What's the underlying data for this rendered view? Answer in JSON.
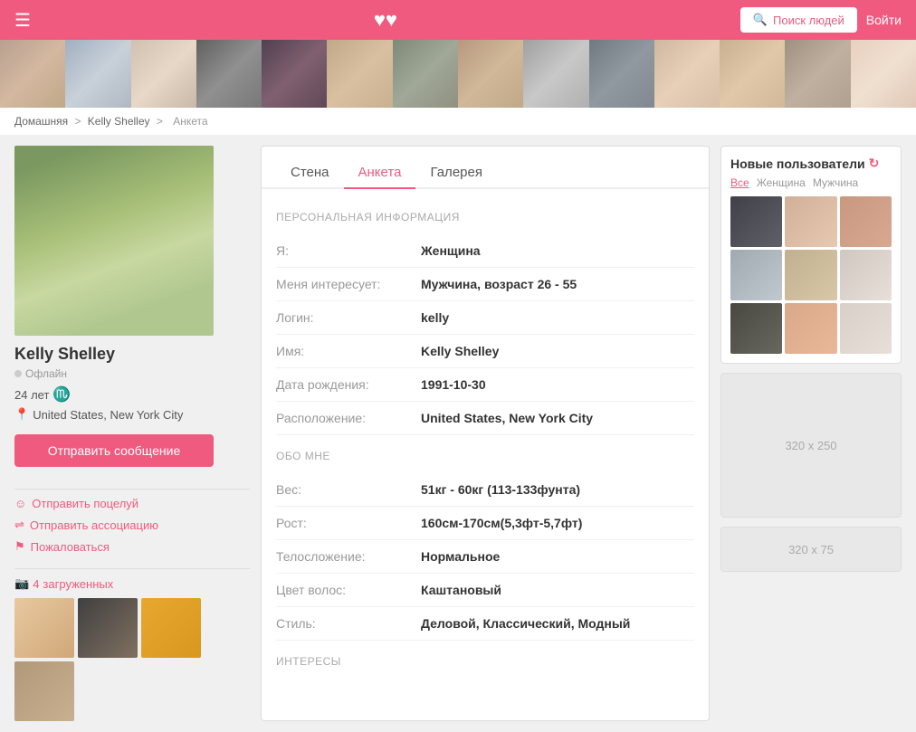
{
  "header": {
    "search_btn": "Поиск людей",
    "login_btn": "Войти"
  },
  "breadcrumb": {
    "home": "Домашняя",
    "sep1": ">",
    "name": "Kelly Shelley",
    "sep2": ">",
    "page": "Анкета"
  },
  "profile": {
    "name": "Kelly Shelley",
    "status": "Офлайн",
    "age": "24 лет",
    "zodiac": "♏",
    "location": "United States, New York City",
    "send_msg": "Отправить сообщение",
    "action_kiss": "Отправить поцелуй",
    "action_assoc": "Отправить ассоциацию",
    "action_report": "Пожаловаться",
    "uploads_label": "загруженных",
    "uploads_count": "4"
  },
  "tabs": {
    "wall": "Стена",
    "anketa": "Анкета",
    "gallery": "Галерея"
  },
  "personal_info": {
    "section_title": "ПЕРСОНАЛЬНАЯ ИНФОРМАЦИЯ",
    "fields": [
      {
        "label": "Я:",
        "value": "Женщина"
      },
      {
        "label": "Меня интересует:",
        "value": "Мужчина, возраст 26 - 55"
      },
      {
        "label": "Логин:",
        "value": "kelly"
      },
      {
        "label": "Имя:",
        "value": "Kelly Shelley"
      },
      {
        "label": "Дата рождения:",
        "value": "1991-10-30"
      },
      {
        "label": "Расположение:",
        "value": "United States, New York City"
      }
    ]
  },
  "about_me": {
    "section_title": "ОБО МНЕ",
    "fields": [
      {
        "label": "Вес:",
        "value": "51кг - 60кг (113-133фунта)"
      },
      {
        "label": "Рост:",
        "value": "160см-170см(5,3фт-5,7фт)"
      },
      {
        "label": "Телосложение:",
        "value": "Нормальное"
      },
      {
        "label": "Цвет волос:",
        "value": "Каштановый"
      },
      {
        "label": "Стиль:",
        "value": "Деловой, Классический, Модный"
      }
    ]
  },
  "interests": {
    "section_title": "ИНТЕРЕСЫ"
  },
  "new_users": {
    "title": "Новые пользователи",
    "filter_all": "Все",
    "filter_female": "Женщина",
    "filter_male": "Мужчина"
  },
  "ads": {
    "big": "320 x 250",
    "small": "320 x 75"
  }
}
